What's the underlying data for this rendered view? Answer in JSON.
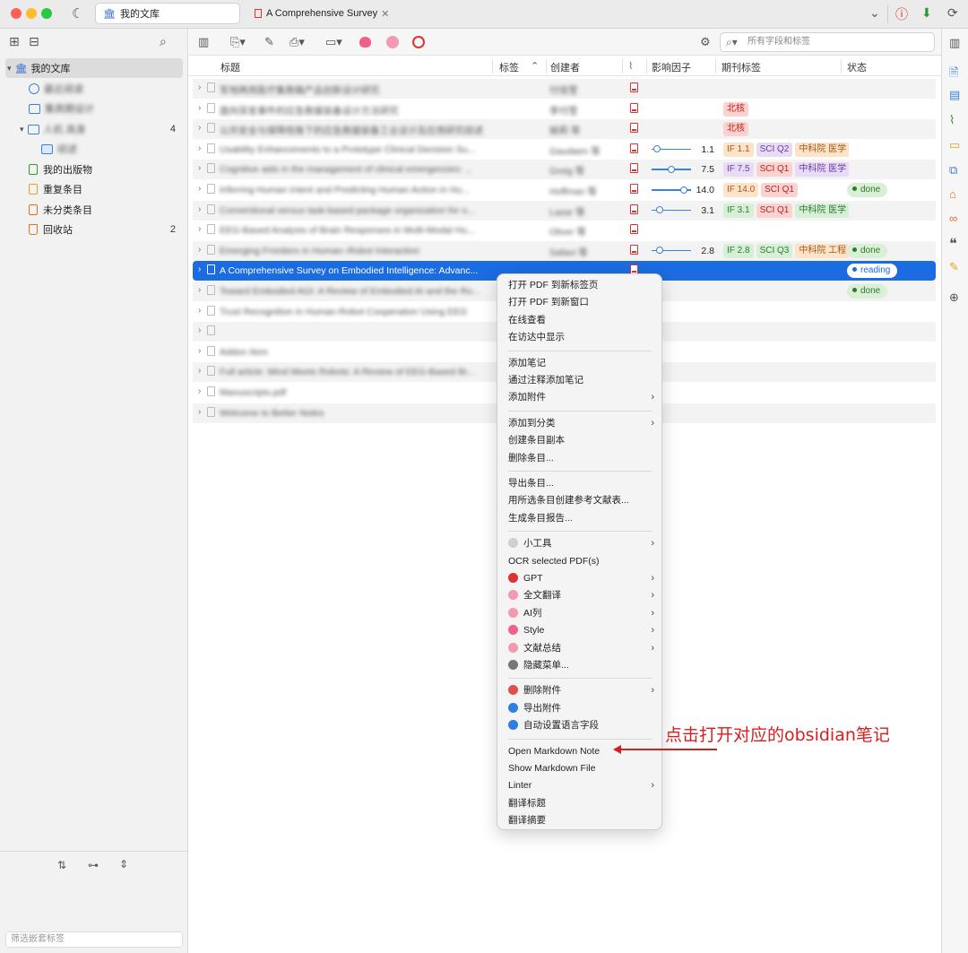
{
  "window": {
    "tabs": [
      {
        "label": "我的文库",
        "icon": "library-icon"
      },
      {
        "label": "A Comprehensive Survey",
        "icon": "pdf-icon"
      }
    ]
  },
  "sidebar": {
    "library": "我的文库",
    "items": [
      {
        "label": "最近阅读",
        "blurred": true
      },
      {
        "label": "集商期设计",
        "blurred": true
      },
      {
        "label": "人机 具身",
        "blurred": true,
        "count": "4"
      },
      {
        "label": "综述",
        "blurred": true
      },
      {
        "label": "我的出版物"
      },
      {
        "label": "重复条目"
      },
      {
        "label": "未分类条目"
      },
      {
        "label": "回收站",
        "count": "2"
      }
    ],
    "tag_filter_placeholder": "筛选嵌套标签"
  },
  "toolbar": {
    "search_placeholder": "所有字段和标签"
  },
  "columns": {
    "title": "标题",
    "tags": "标签",
    "creator": "创建者",
    "impact": "影响因子",
    "journal_tags": "期刊标签",
    "status": "状态"
  },
  "rows": [
    {
      "title": "军地两用医疗集救箱产品创新设计研究",
      "creator": "付佳莹",
      "blur": true
    },
    {
      "title": "面向突发事件的应急救援装备设计方法研究",
      "creator": "李付莹",
      "blur": true,
      "badges": [
        {
          "text": "北核",
          "cls": "b-bk"
        }
      ]
    },
    {
      "title": "公共安全与保障视角下的应急救援装备工业设计及应用研究综述",
      "creator": "姚莉 等",
      "blur": true,
      "badges": [
        {
          "text": "北核",
          "cls": "b-bk"
        }
      ]
    },
    {
      "title": "Usability Enhancements to a Prototype Clinical Decision Su...",
      "creator": "Gaudaen 等",
      "blur": true,
      "if": "1.1",
      "knob": 0.05,
      "badges": [
        {
          "text": "IF 1.1",
          "cls": "b-if"
        },
        {
          "text": "SCI Q2",
          "cls": "b-sci2"
        },
        {
          "text": "中科院 医学",
          "cls": "b-cas2"
        }
      ]
    },
    {
      "title": "Cognitive aids in the management of clinical emergencies: ...",
      "creator": "Greig 等",
      "blur": true,
      "if": "7.5",
      "knob": 0.5,
      "badges": [
        {
          "text": "IF 7.5",
          "cls": "b-sci2"
        },
        {
          "text": "SCI Q1",
          "cls": "b-sci"
        },
        {
          "text": "中科院 医学",
          "cls": "b-sci2"
        }
      ]
    },
    {
      "title": "Inferring Human Intent and Predicting Human Action in Hu...",
      "creator": "Hoffman 等",
      "blur": true,
      "if": "14.0",
      "knob": 0.9,
      "badges": [
        {
          "text": "IF 14.0",
          "cls": "b-if"
        },
        {
          "text": "SCI Q1",
          "cls": "b-sci"
        }
      ],
      "status": "done"
    },
    {
      "title": "Conventional versus task-based package organization for o...",
      "creator": "Lazar 等",
      "blur": true,
      "if": "3.1",
      "knob": 0.15,
      "badges": [
        {
          "text": "IF 3.1",
          "cls": "b-cas"
        },
        {
          "text": "SCI Q1",
          "cls": "b-sci"
        },
        {
          "text": "中科院 医学",
          "cls": "b-cas"
        }
      ]
    },
    {
      "title": "EEG-Based Analysis of Brain Responses in Multi-Modal Hu...",
      "creator": "Oliver 等",
      "blur": true
    },
    {
      "title": "Emerging Frontiers in Human–Robot Interaction",
      "creator": "Safavi 等",
      "blur": true,
      "if": "2.8",
      "knob": 0.15,
      "badges": [
        {
          "text": "IF 2.8",
          "cls": "b-cas"
        },
        {
          "text": "SCI Q3",
          "cls": "b-sci3"
        },
        {
          "text": "中科院 工程",
          "cls": "b-cas2"
        }
      ],
      "status": "done"
    },
    {
      "title": "A Comprehensive Survey on Embodied Intelligence: Advanc...",
      "creator": "",
      "selected": true,
      "status": "reading"
    },
    {
      "title": "Toward Embodied AGI: A Review of Embodied AI and the Ro...",
      "creator": "",
      "blur": true,
      "status": "done"
    },
    {
      "title": "Trust Recognition in Human-Robot Cooperation Using EEG",
      "creator": "",
      "blur": true
    },
    {
      "title": "",
      "creator": "",
      "blur": true
    },
    {
      "title": "Addon Item",
      "creator": "",
      "blur": true
    },
    {
      "title": "Full article: Mind Meets Robots: A Review of EEG-Based Br...",
      "creator": "",
      "blur": true
    },
    {
      "title": "Manuscripts.pdf",
      "creator": "",
      "blur": true
    },
    {
      "title": "Welcome to Better Notes",
      "creator": "",
      "blur": true
    }
  ],
  "context_menu": {
    "groups": [
      [
        {
          "label": "打开 PDF 到新标签页"
        },
        {
          "label": "打开 PDF 到新窗口"
        },
        {
          "label": "在线查看"
        },
        {
          "label": "在访达中显示"
        }
      ],
      [
        {
          "label": "添加笔记"
        },
        {
          "label": "通过注释添加笔记"
        },
        {
          "label": "添加附件",
          "submenu": true
        }
      ],
      [
        {
          "label": "添加到分类",
          "submenu": true
        },
        {
          "label": "创建条目副本"
        },
        {
          "label": "删除条目..."
        }
      ],
      [
        {
          "label": "导出条目..."
        },
        {
          "label": "用所选条目创建参考文献表..."
        },
        {
          "label": "生成条目报告..."
        }
      ],
      [
        {
          "label": "小工具",
          "submenu": true,
          "icon": "#cfcfcf"
        },
        {
          "label": "OCR selected PDF(s)"
        },
        {
          "label": "GPT",
          "submenu": true,
          "icon": "#d33"
        },
        {
          "label": "全文翻译",
          "submenu": true,
          "icon": "#f29ab0"
        },
        {
          "label": "AI列",
          "submenu": true,
          "icon": "#f29ab0"
        },
        {
          "label": "Style",
          "submenu": true,
          "icon": "#f0608a"
        },
        {
          "label": "文献总结",
          "submenu": true,
          "icon": "#f29ab0"
        },
        {
          "label": "隐藏菜单...",
          "icon": "#777"
        }
      ],
      [
        {
          "label": "删除附件",
          "submenu": true,
          "icon": "#e0504a"
        },
        {
          "label": "导出附件",
          "icon": "#2f7fe0"
        },
        {
          "label": "自动设置语言字段",
          "icon": "#2f7fe0"
        }
      ],
      [
        {
          "label": "Open Markdown Note"
        },
        {
          "label": "Show Markdown File"
        },
        {
          "label": "Linter",
          "submenu": true
        },
        {
          "label": "翻译标题"
        },
        {
          "label": "翻译摘要"
        }
      ]
    ]
  },
  "annotation": {
    "text": "点击打开对应的obsidian笔记",
    "color": "#d42020"
  }
}
